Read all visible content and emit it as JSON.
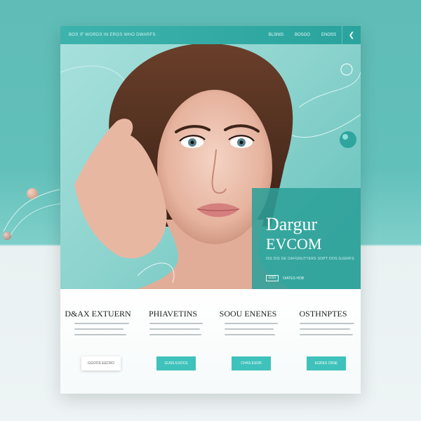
{
  "colors": {
    "accent": "#2fa59e",
    "button": "#3fc2bb",
    "background": "#5fbcb6"
  },
  "header": {
    "brand": "BOS IF WORDS IN ERGS WHO DWARFS",
    "nav": [
      "BLSNIS",
      "BOSGO",
      "ENOSS"
    ],
    "menu_icon": "chevron-icon"
  },
  "hero": {
    "title_line1": "Dargur",
    "title_line2": "EVCOM",
    "subtitle": "ISS DIS GE DAFGNUTTERS SOPT DOS GUERFS",
    "cta_box": "GSO",
    "cta_label": "OIATES HOB"
  },
  "features": [
    {
      "title": "D&AX EXTUERN",
      "button": "GGOOS EECRO",
      "style": "white"
    },
    {
      "title": "PHIAVETINS",
      "button": "GUSS EXOCS",
      "style": "teal"
    },
    {
      "title": "SOOU ENENES",
      "button": "CHAS ESOR",
      "style": "teal"
    },
    {
      "title": "OSTHNPTES",
      "button": "EGRES CBSE",
      "style": "teal"
    }
  ]
}
